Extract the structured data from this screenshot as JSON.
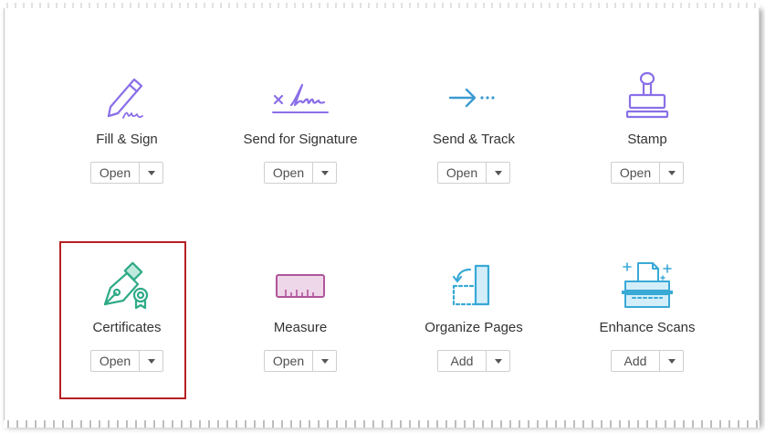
{
  "tools": [
    {
      "name": "Fill & Sign",
      "action": "Open",
      "icon": "fill-sign-icon"
    },
    {
      "name": "Send for Signature",
      "action": "Open",
      "icon": "send-for-signature-icon"
    },
    {
      "name": "Send & Track",
      "action": "Open",
      "icon": "send-track-icon"
    },
    {
      "name": "Stamp",
      "action": "Open",
      "icon": "stamp-icon"
    },
    {
      "name": "Certificates",
      "action": "Open",
      "icon": "certificates-icon"
    },
    {
      "name": "Measure",
      "action": "Open",
      "icon": "measure-icon"
    },
    {
      "name": "Organize Pages",
      "action": "Add",
      "icon": "organize-pages-icon"
    },
    {
      "name": "Enhance Scans",
      "action": "Add",
      "icon": "enhance-scans-icon"
    }
  ],
  "colors": {
    "purple": "#8a6fe8",
    "blue": "#3d9ad1",
    "green": "#2eaa86",
    "pink": "#b0559a",
    "cyan": "#39a9d6",
    "highlight": "#b62024"
  }
}
